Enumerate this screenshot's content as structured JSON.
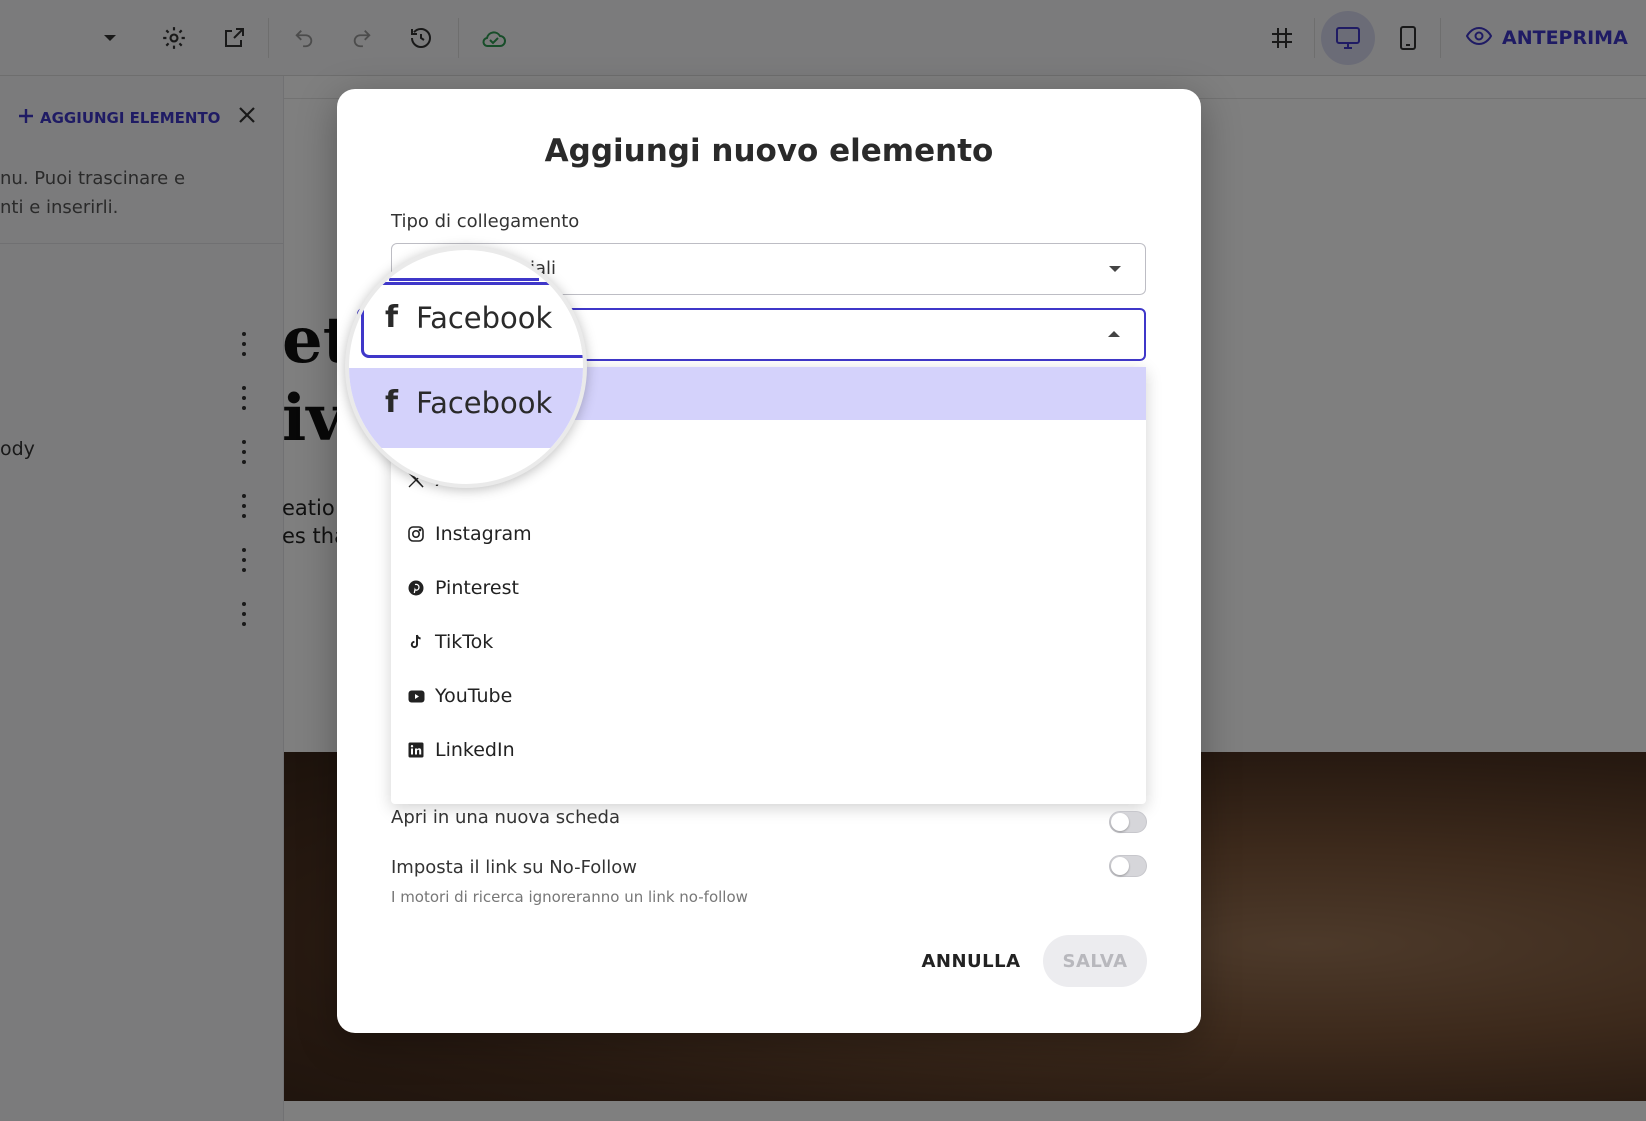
{
  "topbar": {
    "preview_label": "ANTEPRIMA",
    "icons": [
      "chevron-down-icon",
      "gear-icon",
      "external-link-icon",
      "undo-icon",
      "redo-icon",
      "history-icon",
      "cloud-check-icon",
      "grid-icon",
      "desktop-icon",
      "mobile-icon",
      "eye-icon"
    ],
    "accent_color": "#3f37c9"
  },
  "sidebar": {
    "add_element_label": "AGGIUNGI ELEMENTO",
    "description_line1": "nu. Puoi trascinare e",
    "description_line2": "nti e inserirli.",
    "body_fragment": "ody"
  },
  "canvas": {
    "hero_fragment_1": "et",
    "hero_fragment_2": "iv",
    "body_fragment_1": "eatio",
    "body_fragment_2": "es tha"
  },
  "modal": {
    "title": "Aggiungi nuovo elemento",
    "link_type_label": "Tipo di collegamento",
    "link_type_value_visible": "iali",
    "network_selected": "Facebook",
    "options": [
      {
        "label": "Facebook",
        "icon": "facebook-icon"
      },
      {
        "label": "X",
        "icon": "x-icon"
      },
      {
        "label": "Instagram",
        "icon": "instagram-icon"
      },
      {
        "label": "Pinterest",
        "icon": "pinterest-icon"
      },
      {
        "label": "TikTok",
        "icon": "tiktok-icon"
      },
      {
        "label": "YouTube",
        "icon": "youtube-icon"
      },
      {
        "label": "LinkedIn",
        "icon": "linkedin-icon"
      }
    ],
    "new_tab_label": "Apri in una nuova scheda",
    "nofollow_label": "Imposta il link su No-Follow",
    "nofollow_helper": "I motori di ricerca ignoreranno un link no-follow",
    "new_tab_on": false,
    "nofollow_on": false,
    "cancel_label": "ANNULLA",
    "save_label": "SALVA",
    "highlight_color": "#d4d2fb"
  }
}
